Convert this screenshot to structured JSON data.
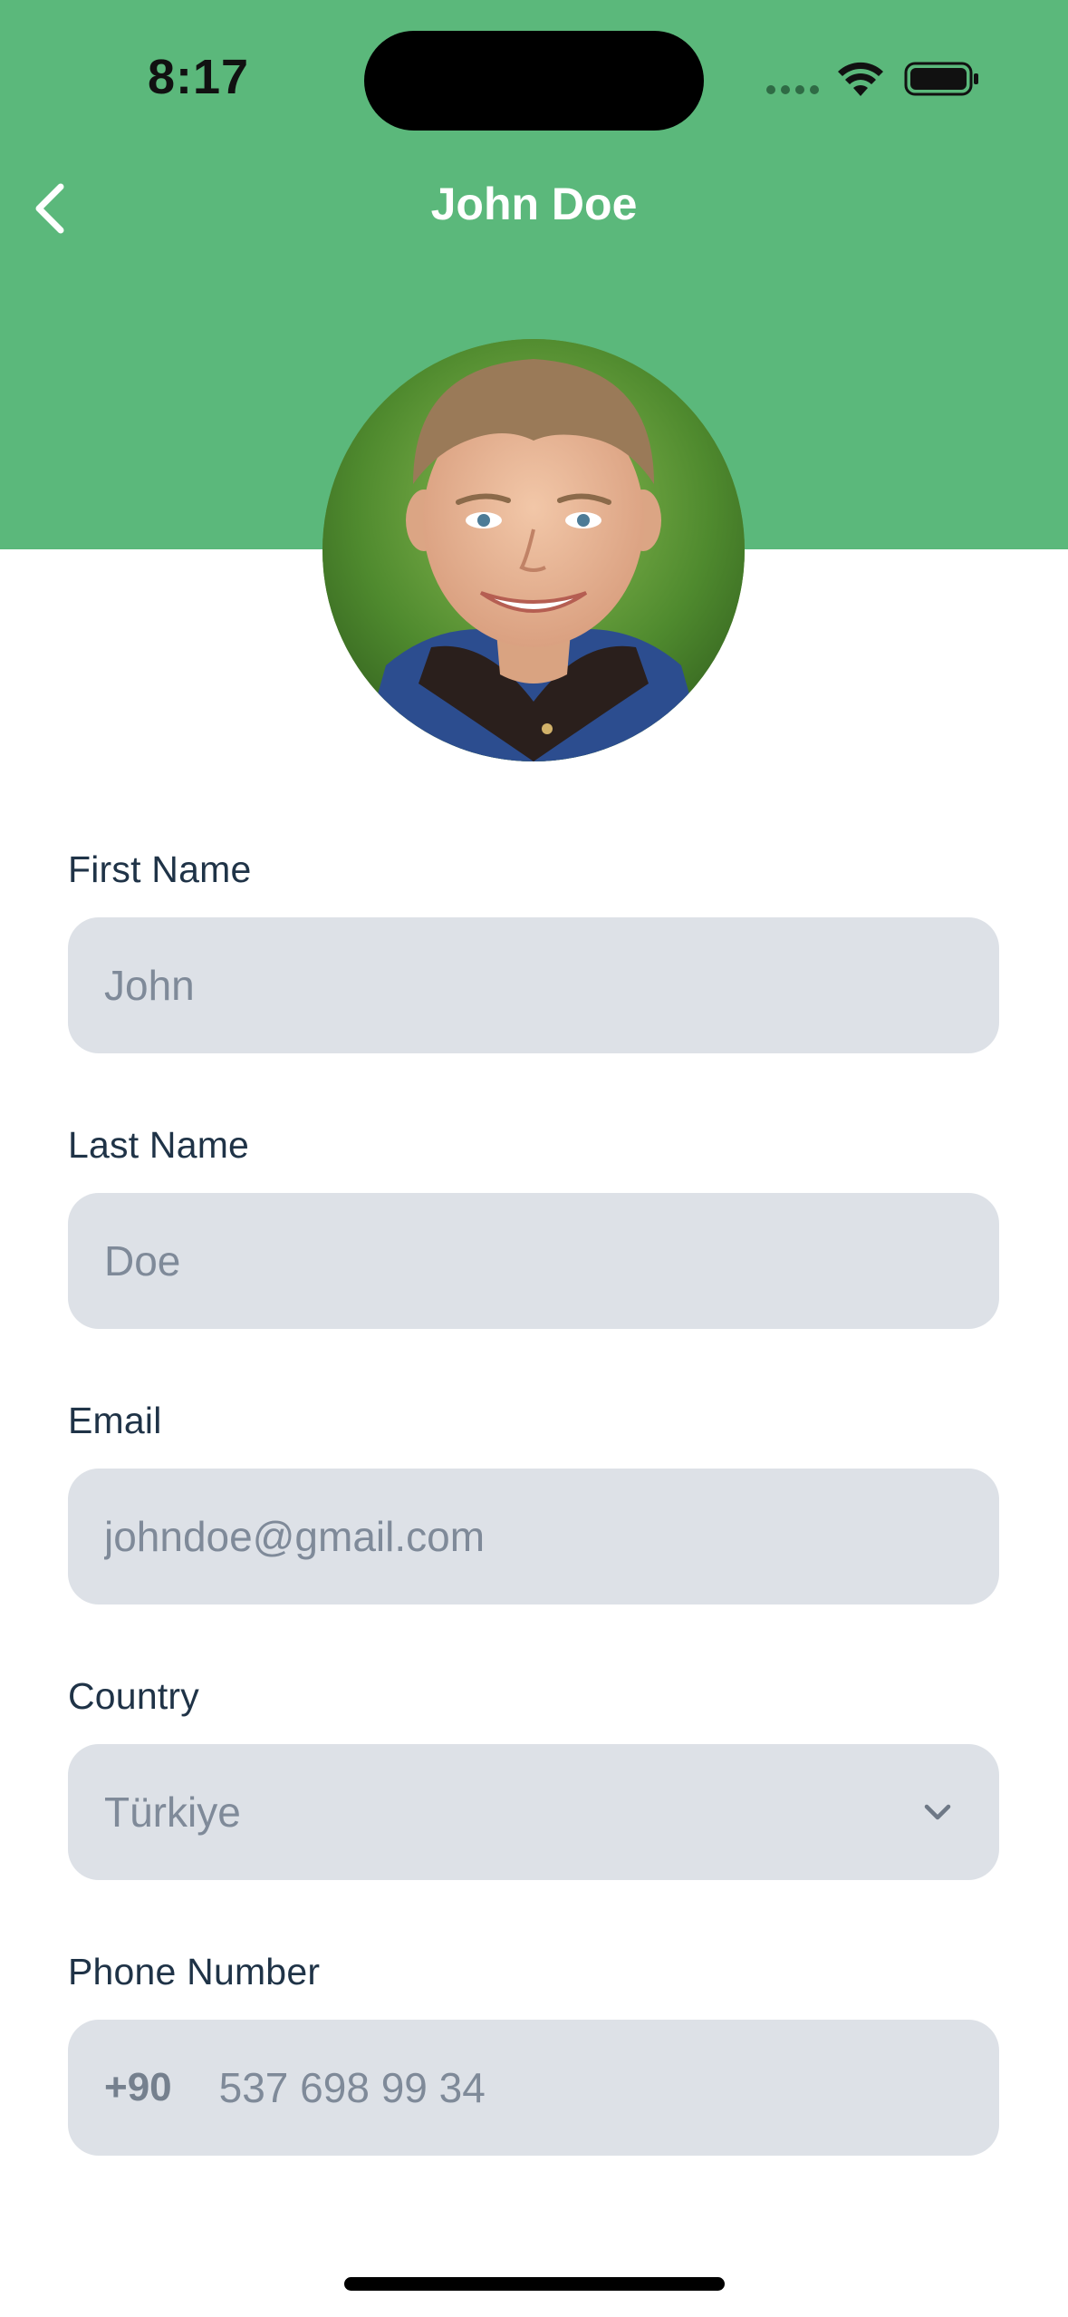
{
  "status_bar": {
    "time": "8:17"
  },
  "nav": {
    "title": "John Doe",
    "back_icon": "chevron-left-icon"
  },
  "profile": {
    "avatar_alt": "Profile photo"
  },
  "form": {
    "first_name": {
      "label": "First Name",
      "placeholder": "John"
    },
    "last_name": {
      "label": "Last Name",
      "placeholder": "Doe"
    },
    "email": {
      "label": "Email",
      "placeholder": "johndoe@gmail.com"
    },
    "country": {
      "label": "Country",
      "value": "Türkiye",
      "icon": "chevron-down-icon"
    },
    "phone": {
      "label": "Phone Number",
      "prefix": "+90",
      "placeholder": "537 698 99 34"
    }
  },
  "colors": {
    "header_green": "#5bb87b",
    "field_bg": "#dde1e7",
    "label_text": "#1f3347",
    "placeholder_text": "#7f8a99"
  }
}
